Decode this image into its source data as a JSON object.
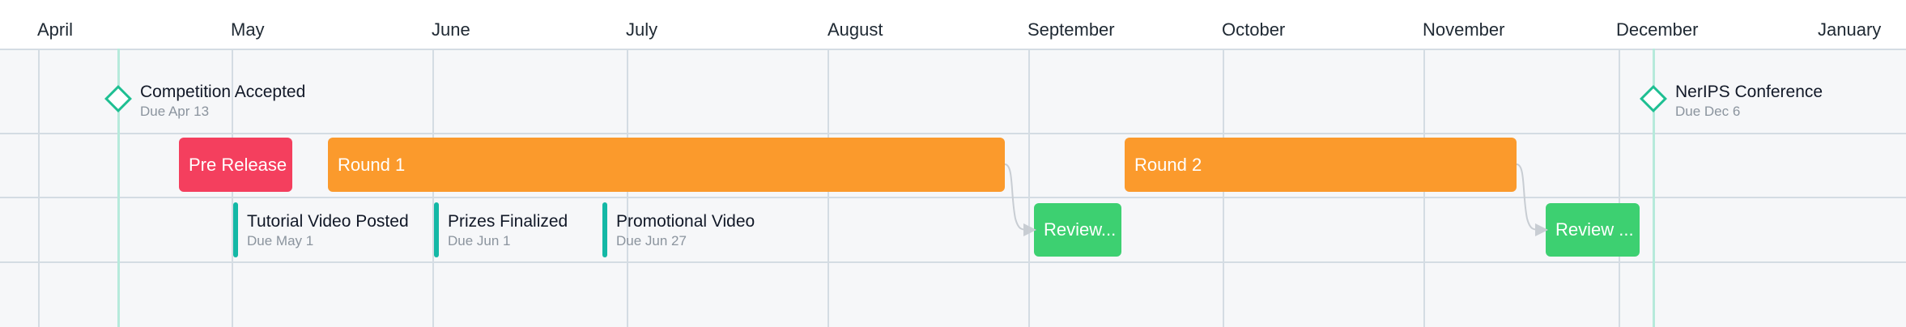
{
  "months": [
    "April",
    "May",
    "June",
    "July",
    "August",
    "September",
    "October",
    "November",
    "December",
    "January"
  ],
  "milestones": [
    {
      "title": "Competition Accepted",
      "due": "Due Apr 13"
    },
    {
      "title": "NerIPS Conference",
      "due": "Due Dec 6"
    }
  ],
  "bars": [
    {
      "label": "Pre Release",
      "color": "#f43f5e"
    },
    {
      "label": "Round 1",
      "color": "#fb9a2c"
    },
    {
      "label": "Round 2",
      "color": "#fb9a2c"
    },
    {
      "label": "Review...",
      "color": "#3dd071"
    },
    {
      "label": "Review ...",
      "color": "#3dd071"
    }
  ],
  "tasks": [
    {
      "title": "Tutorial Video Posted",
      "due": "Due May 1"
    },
    {
      "title": "Prizes Finalized",
      "due": "Due Jun 1"
    },
    {
      "title": "Promotional Video",
      "due": "Due Jun 27"
    }
  ],
  "colors": {
    "milestone": "#1ebf92",
    "task_marker": "#14b8a6",
    "grid": "#d4dce3",
    "arrow": "#c8cdd3"
  }
}
